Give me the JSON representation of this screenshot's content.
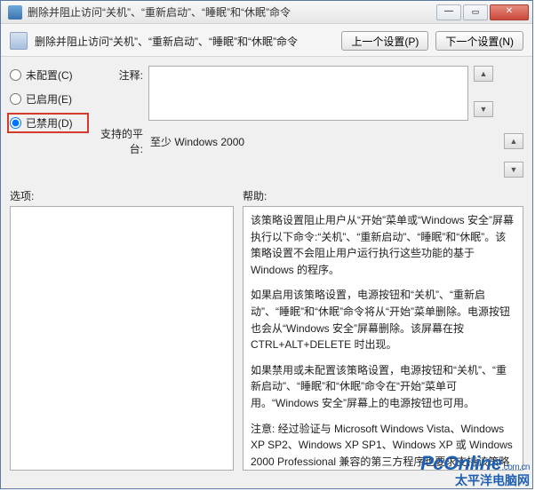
{
  "window": {
    "title": "删除并阻止访问“关机”、“重新启动”、“睡眠”和“休眠”命令"
  },
  "header": {
    "policy_title": "删除并阻止访问“关机”、“重新启动”、“睡眠”和“休眠”命令",
    "prev_btn": "上一个设置(P)",
    "next_btn": "下一个设置(N)"
  },
  "radios": {
    "not_configured": "未配置(C)",
    "enabled": "已启用(E)",
    "disabled": "已禁用(D)"
  },
  "comment": {
    "label": "注释:",
    "value": ""
  },
  "platform": {
    "label": "支持的平台:",
    "value": "至少 Windows 2000"
  },
  "options": {
    "label": "选项:"
  },
  "help": {
    "label": "帮助:",
    "p1": "该策略设置阻止用户从“开始”菜单或“Windows 安全”屏幕执行以下命令:“关机”、“重新启动”、“睡眠”和“休眠”。该策略设置不会阻止用户运行执行这些功能的基于 Windows 的程序。",
    "p2": "如果启用该策略设置，电源按钮和“关机”、“重新启动”、“睡眠”和“休眠”命令将从“开始”菜单删除。电源按钮也会从“Windows 安全”屏幕删除。该屏幕在按 CTRL+ALT+DELETE 时出现。",
    "p3": "如果禁用或未配置该策略设置，电源按钮和“关机”、“重新启动”、“睡眠”和“休眠”命令在“开始”菜单可用。“Windows 安全”屏幕上的电源按钮也可用。",
    "p4": "注意: 经过验证与 Microsoft Windows Vista、Windows XP SP2、Windows XP SP1、Windows XP 或 Windows 2000 Professional 兼容的第三方程序也要求支持该策略设置。"
  },
  "watermark": {
    "line1_main": "PcOnline",
    "line1_suffix": ".com.cn",
    "line2": "太平洋电脑网"
  }
}
